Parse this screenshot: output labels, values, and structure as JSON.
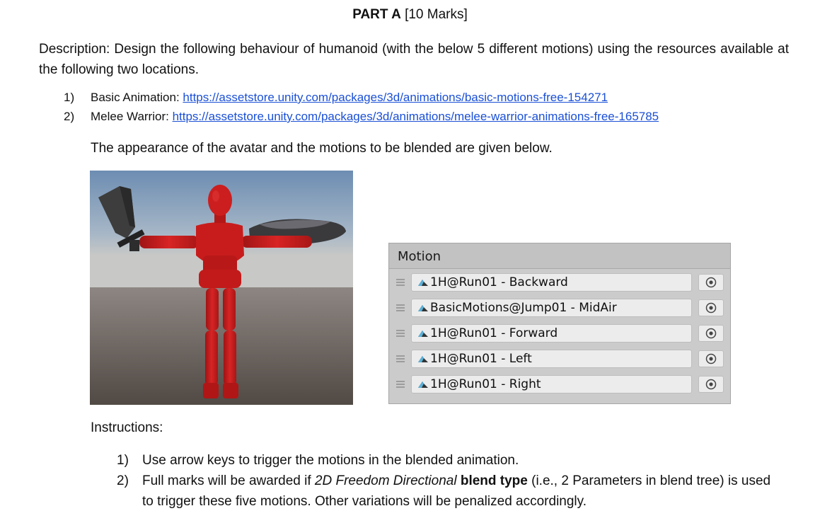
{
  "header": {
    "title_bold": "PART A",
    "title_rest": " [10 Marks]"
  },
  "description": "Description: Design the following behaviour of humanoid (with the below 5 different motions) using the resources available at the following two locations.",
  "resources": [
    {
      "num": "1)",
      "label": "Basic Animation: ",
      "link": "https://assetstore.unity.com/packages/3d/animations/basic-motions-free-154271"
    },
    {
      "num": "2)",
      "label": "Melee Warrior: ",
      "link": "https://assetstore.unity.com/packages/3d/animations/melee-warrior-animations-free-165785"
    }
  ],
  "intro": "The appearance of the avatar and the motions to be blended are given below.",
  "motion_panel": {
    "header": "Motion",
    "clip_icon": "animation-clip-icon",
    "picker_icon": "object-picker-icon",
    "items": [
      {
        "label": "1H@Run01 - Backward"
      },
      {
        "label": "BasicMotions@Jump01 - MidAir"
      },
      {
        "label": "1H@Run01 - Forward"
      },
      {
        "label": "1H@Run01 - Left"
      },
      {
        "label": "1H@Run01 - Right"
      }
    ]
  },
  "instructions": {
    "heading": "Instructions:",
    "items": [
      {
        "num": "1)",
        "text": "Use arrow keys to trigger the motions in the blended animation."
      },
      {
        "num": "2)",
        "pre": "Full marks will be awarded if ",
        "italic": "2D Freedom Directional",
        "bold": " blend type",
        "post": " (i.e., 2 Parameters in blend tree) is used to trigger these five motions. Other variations will be penalized accordingly."
      }
    ]
  },
  "colors": {
    "link": "#1a4fd6",
    "avatar_body": "#c81c1c",
    "sky_top": "#6f8fb3",
    "ground": "#5a524d"
  }
}
